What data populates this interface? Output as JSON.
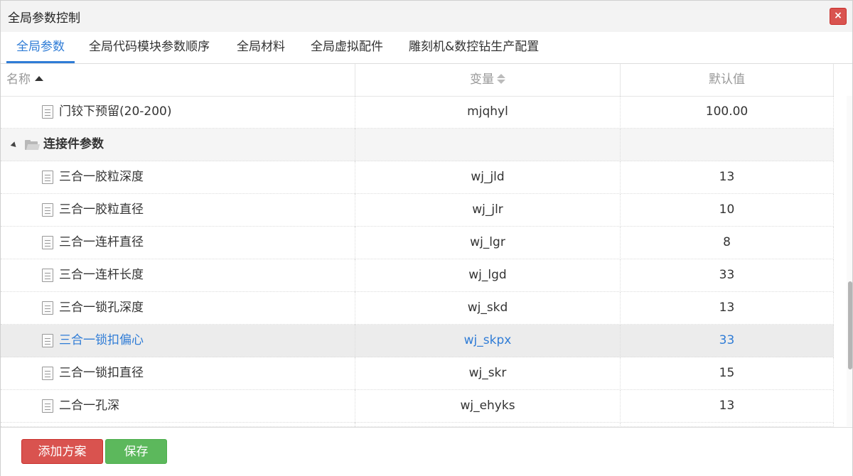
{
  "dialog": {
    "title": "全局参数控制",
    "close_label": "×"
  },
  "tabs": [
    {
      "label": "全局参数",
      "active": true
    },
    {
      "label": "全局代码模块参数顺序",
      "active": false
    },
    {
      "label": "全局材料",
      "active": false
    },
    {
      "label": "全局虚拟配件",
      "active": false
    },
    {
      "label": "雕刻机&数控钻生产配置",
      "active": false
    }
  ],
  "grid": {
    "columns": {
      "name": "名称",
      "variable": "变量",
      "default": "默认值"
    },
    "rows": [
      {
        "type": "leaf",
        "name": "门铰下预留(20-200)",
        "variable": "mjqhyl",
        "default": "100.00"
      },
      {
        "type": "group",
        "name": "连接件参数"
      },
      {
        "type": "leaf",
        "name": "三合一胶粒深度",
        "variable": "wj_jld",
        "default": "13"
      },
      {
        "type": "leaf",
        "name": "三合一胶粒直径",
        "variable": "wj_jlr",
        "default": "10"
      },
      {
        "type": "leaf",
        "name": "三合一连杆直径",
        "variable": "wj_lgr",
        "default": "8"
      },
      {
        "type": "leaf",
        "name": "三合一连杆长度",
        "variable": "wj_lgd",
        "default": "33"
      },
      {
        "type": "leaf",
        "name": "三合一锁孔深度",
        "variable": "wj_skd",
        "default": "13"
      },
      {
        "type": "leaf",
        "name": "三合一锁扣偏心",
        "variable": "wj_skpx",
        "default": "33",
        "highlighted": true
      },
      {
        "type": "leaf",
        "name": "三合一锁扣直径",
        "variable": "wj_skr",
        "default": "15"
      },
      {
        "type": "leaf",
        "name": "二合一孔深",
        "variable": "wj_ehyks",
        "default": "13"
      }
    ]
  },
  "footer": {
    "add_label": "添加方案",
    "save_label": "保存"
  },
  "colors": {
    "accent": "#2f7cd6",
    "danger": "#d9534f",
    "success": "#5cb85c"
  }
}
